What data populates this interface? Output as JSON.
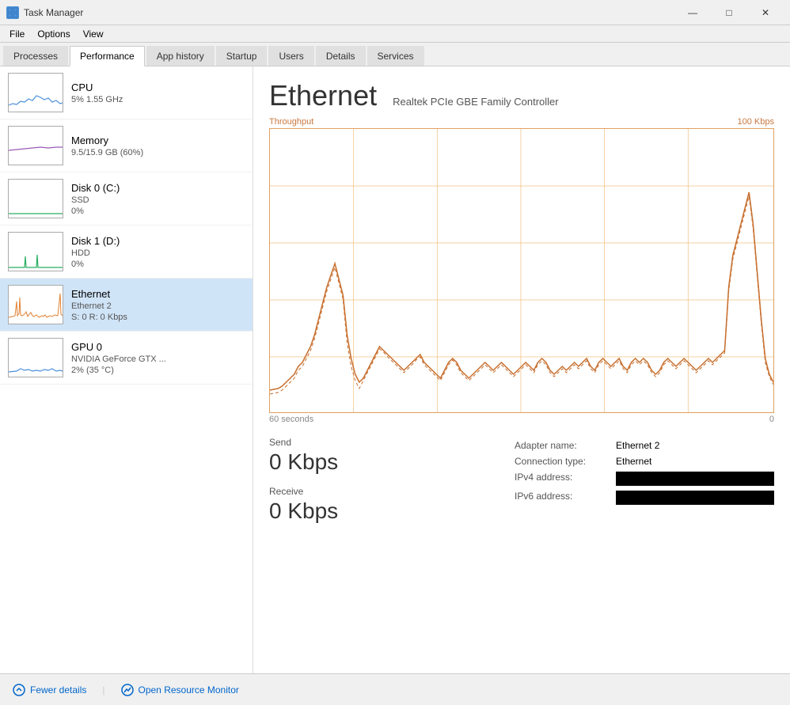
{
  "titlebar": {
    "icon": "⚙",
    "title": "Task Manager",
    "minimize": "—",
    "maximize": "□",
    "close": "✕"
  },
  "menubar": {
    "items": [
      "File",
      "Options",
      "View"
    ]
  },
  "tabs": {
    "items": [
      "Processes",
      "Performance",
      "App history",
      "Startup",
      "Users",
      "Details",
      "Services"
    ],
    "active": "Performance"
  },
  "sidebar": {
    "items": [
      {
        "id": "cpu",
        "name": "CPU",
        "sub1": "5%  1.55 GHz",
        "color": "#4a90d9",
        "selected": false
      },
      {
        "id": "memory",
        "name": "Memory",
        "sub1": "9.5/15.9 GB (60%)",
        "color": "#9b59b6",
        "selected": false
      },
      {
        "id": "disk0",
        "name": "Disk 0 (C:)",
        "sub1": "SSD",
        "sub2": "0%",
        "color": "#27ae60",
        "selected": false
      },
      {
        "id": "disk1",
        "name": "Disk 1 (D:)",
        "sub1": "HDD",
        "sub2": "0%",
        "color": "#27ae60",
        "selected": false
      },
      {
        "id": "ethernet",
        "name": "Ethernet",
        "sub1": "Ethernet 2",
        "sub2": "S: 0  R: 0 Kbps",
        "color": "#e08030",
        "selected": true
      },
      {
        "id": "gpu",
        "name": "GPU 0",
        "sub1": "NVIDIA GeForce GTX ...",
        "sub2": "2%  (35 °C)",
        "color": "#4a90d9",
        "selected": false
      }
    ]
  },
  "panel": {
    "title": "Ethernet",
    "subtitle": "Realtek PCIe GBE Family Controller",
    "chart": {
      "throughput_label": "Throughput",
      "max_label": "100 Kbps",
      "time_label": "60 seconds",
      "zero_label": "0"
    },
    "send": {
      "label": "Send",
      "value": "0 Kbps"
    },
    "receive": {
      "label": "Receive",
      "value": "0 Kbps"
    },
    "info": {
      "adapter_name_label": "Adapter name:",
      "adapter_name_value": "Ethernet 2",
      "connection_type_label": "Connection type:",
      "connection_type_value": "Ethernet",
      "ipv4_label": "IPv4 address:",
      "ipv4_value": "",
      "ipv6_label": "IPv6 address:",
      "ipv6_value": ""
    }
  },
  "bottombar": {
    "fewer_details": "Fewer details",
    "open_monitor": "Open Resource Monitor"
  }
}
